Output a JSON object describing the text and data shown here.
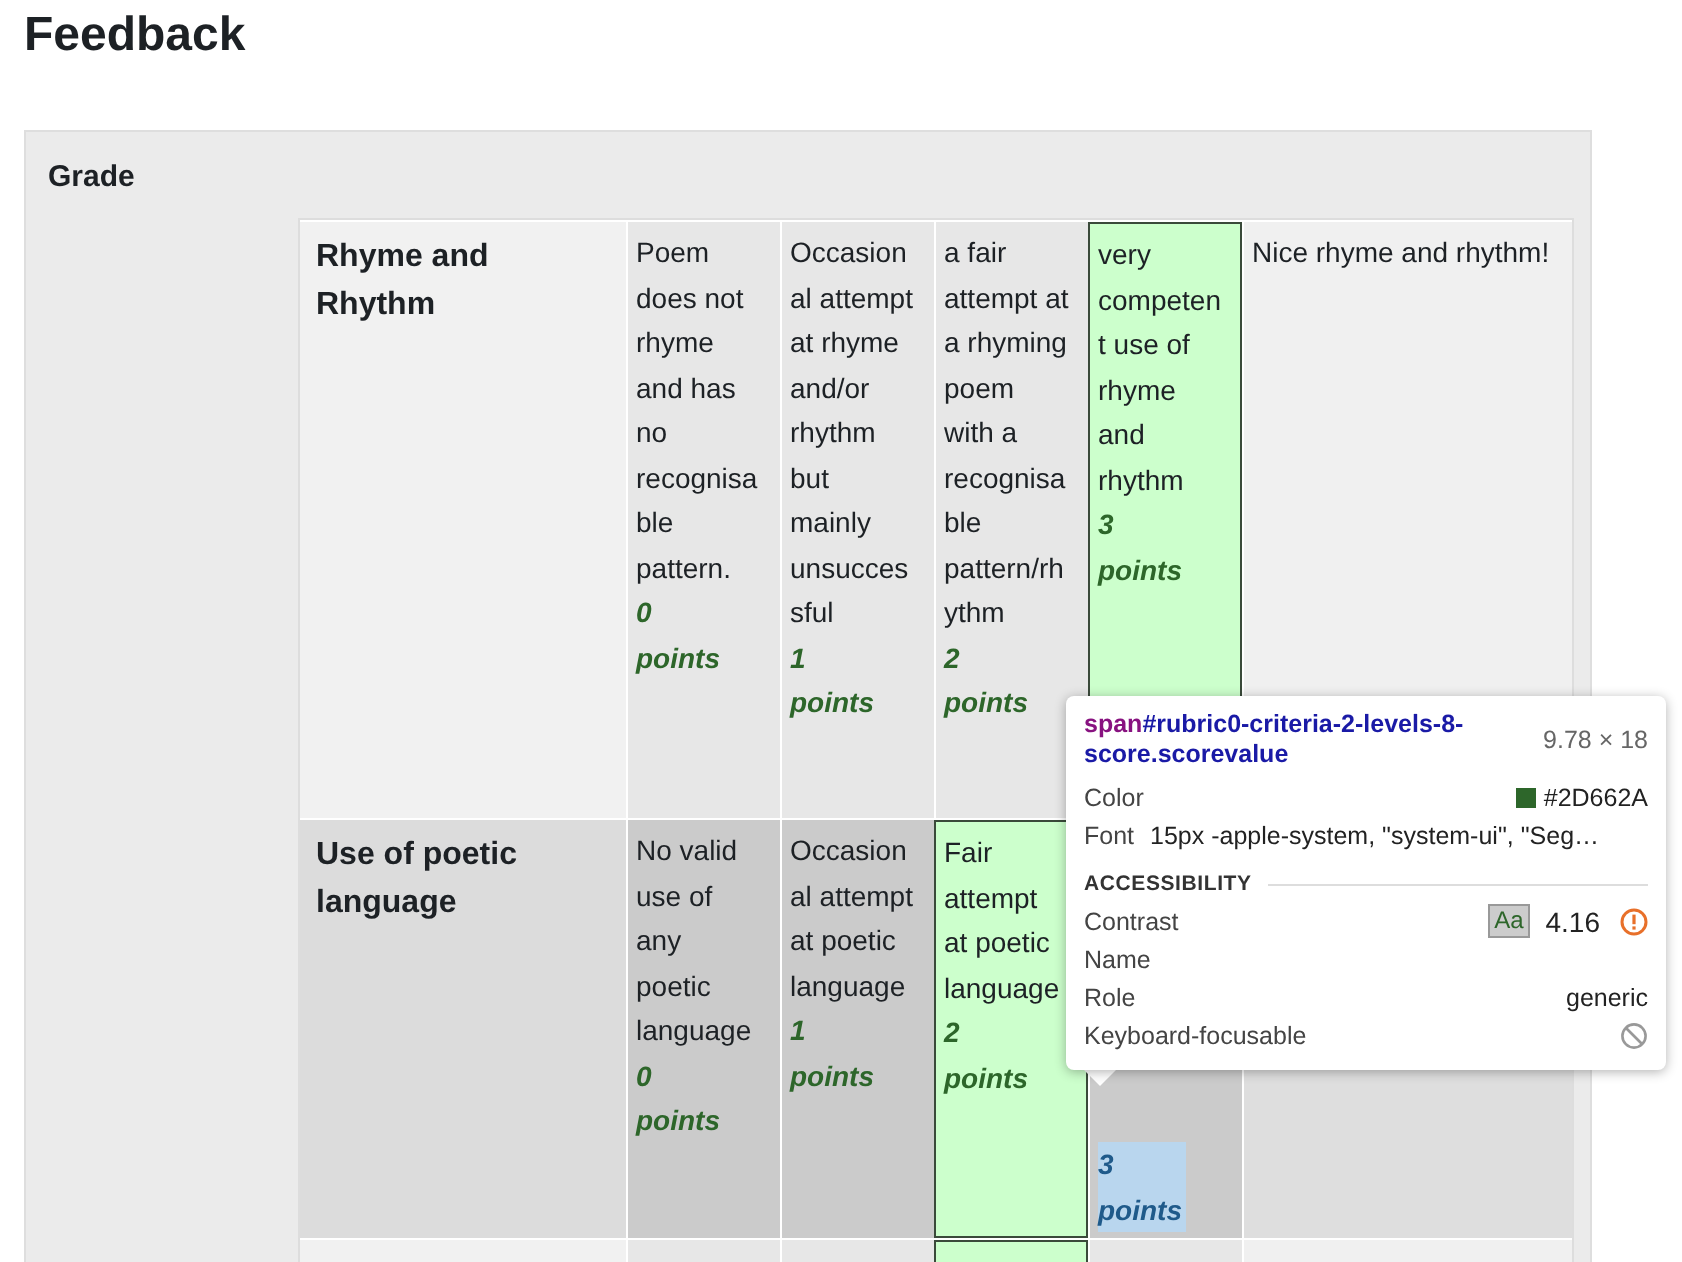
{
  "heading": "Feedback",
  "panel": {
    "title": "Grade"
  },
  "rubric": [
    {
      "criterion": "Rhyme and Rhythm",
      "remark": "Nice rhyme and rhythm!",
      "levels": [
        {
          "description": "Poem does not rhyme and has no recognisable pattern.",
          "score": "0 points",
          "selected": false,
          "inspected": false
        },
        {
          "description": "Occasional attempt at rhyme and/or rhythm but mainly unsuccessful",
          "score": "1 points",
          "selected": false,
          "inspected": false
        },
        {
          "description": "a fair attempt at a rhyming poem with a recognisable pattern/rhythm",
          "score": "2 points",
          "selected": false,
          "inspected": false
        },
        {
          "description": "very competent use of rhyme and rhythm",
          "score": "3 points",
          "selected": true,
          "inspected": false
        }
      ]
    },
    {
      "criterion": "Use of poetic language",
      "levels": [
        {
          "description": "No valid use of any poetic language",
          "score": "0 points",
          "selected": false,
          "inspected": false
        },
        {
          "description": "Occasional attempt at poetic language",
          "score": "1 points",
          "selected": false,
          "inspected": false
        },
        {
          "description": "Fair attempt at poetic language",
          "score": "2 points",
          "selected": true,
          "inspected": false
        },
        {
          "score": "3 points",
          "selected": false,
          "inspected": true
        }
      ]
    },
    {
      "levels": [
        {
          "selected": false
        },
        {
          "selected": false
        },
        {
          "selected": true
        },
        {
          "selected": false
        }
      ]
    }
  ],
  "inspector": {
    "tag": "span",
    "selector": "#rubric0-criteria-2-levels-8-score.scorevalue",
    "size": "9.78 × 18",
    "rows": [
      {
        "kind": "color",
        "label": "Color",
        "value": "#2D662A",
        "color": "#2d662a"
      },
      {
        "kind": "text",
        "label": "Font",
        "value": "15px -apple-system, \"system-ui\", \"Seg…"
      }
    ],
    "section": "ACCESSIBILITY",
    "a11y": [
      {
        "kind": "contrast",
        "label": "Contrast",
        "badge": "Aa",
        "value": "4.16"
      },
      {
        "kind": "text",
        "label": "Name"
      },
      {
        "kind": "text",
        "label": "Role",
        "value": "generic"
      },
      {
        "kind": "blocked",
        "label": "Keyboard-focusable"
      }
    ]
  }
}
